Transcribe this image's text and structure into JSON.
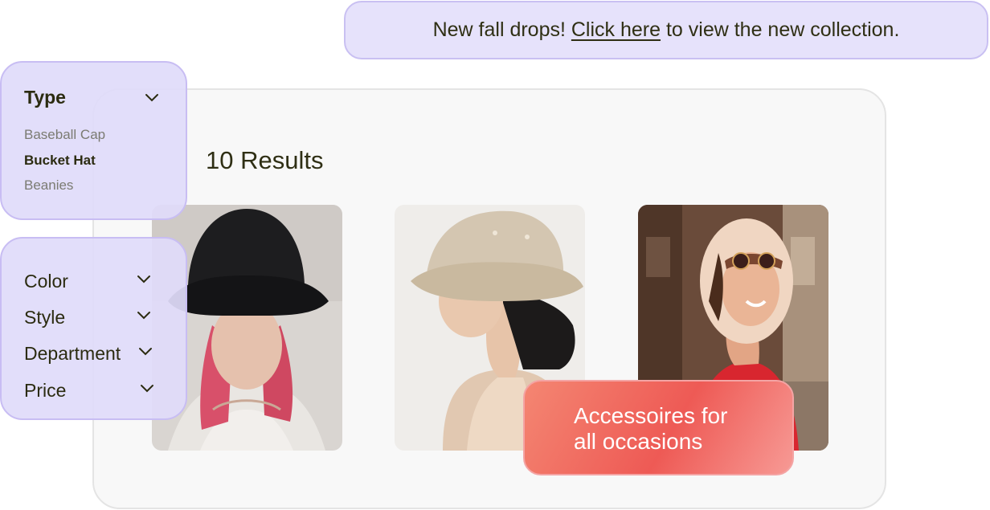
{
  "banner": {
    "text_before": "New fall drops! ",
    "link_text": "Click here",
    "text_after": " to view the new collection."
  },
  "results": {
    "count_label": "10 Results"
  },
  "filters": {
    "type": {
      "label": "Type",
      "options": [
        "Baseball Cap",
        "Bucket Hat",
        "Beanies"
      ],
      "selected": "Bucket Hat"
    },
    "others": [
      {
        "label": "Color"
      },
      {
        "label": "Style"
      },
      {
        "label": "Department"
      },
      {
        "label": "Price"
      }
    ]
  },
  "products": [
    {
      "image": "woman-black-bucket-hat"
    },
    {
      "image": "woman-beige-bucket-hat"
    },
    {
      "image": "woman-wide-brim-hat-sunglasses"
    }
  ],
  "promo": {
    "line1": "Accessoires for",
    "line2": "all occasions"
  },
  "colors": {
    "banner_bg": "#e6e2fb",
    "filter_bg": "#e0dbfa",
    "filter_border": "#c8bdf3",
    "promo_red": "#ee5a55",
    "panel_bg": "#f8f8f8"
  }
}
